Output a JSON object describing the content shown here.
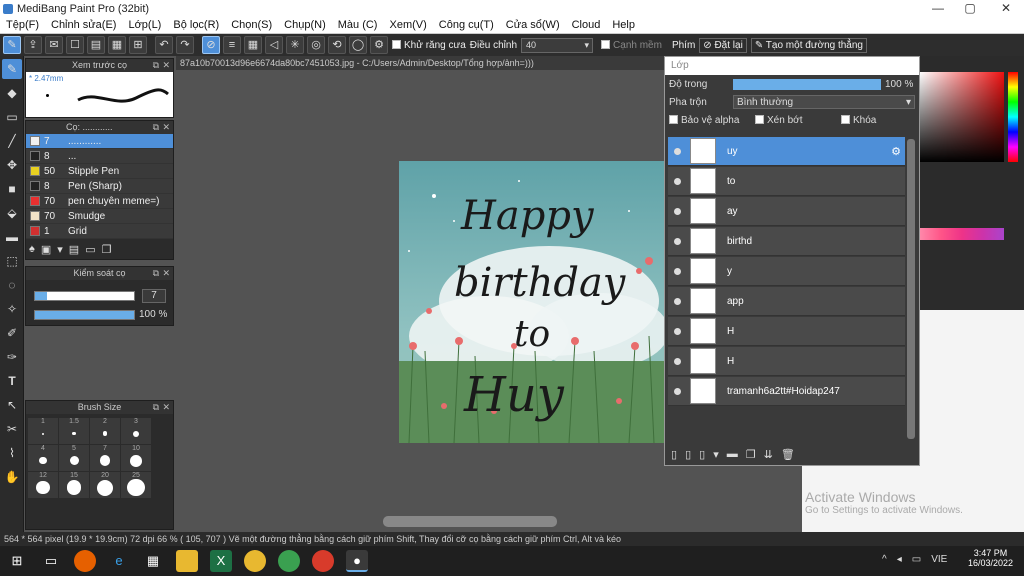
{
  "window": {
    "title": "MediBang Paint Pro (32bit)"
  },
  "menu": [
    "Tệp(F)",
    "Chỉnh sửa(E)",
    "Lớp(L)",
    "Bộ lọc(R)",
    "Chọn(S)",
    "Chụp(N)",
    "Màu (C)",
    "Xem(V)",
    "Công cụ(T)",
    "Cửa sổ(W)",
    "Cloud",
    "Help"
  ],
  "toolbar": {
    "antialias": "Khử răng cưa",
    "adjust_label": "Điều chỉnh",
    "adjust_value": "40",
    "smooth": "Cạnh mềm",
    "key_label": "Phím",
    "reset": "Đặt lại",
    "make_line": "Tạo một đường thẳng"
  },
  "preview": {
    "title": "Xem trước cọ",
    "size": "* 2.47mm"
  },
  "brushes": {
    "title": "Cọ: ............",
    "items": [
      {
        "size": "7",
        "name": "............",
        "color": "#f0f0f0",
        "selected": true
      },
      {
        "size": "8",
        "name": "...",
        "color": "#222222",
        "selected": false
      },
      {
        "size": "50",
        "name": "Stipple Pen",
        "color": "#e8d020",
        "selected": false
      },
      {
        "size": "8",
        "name": "Pen (Sharp)",
        "color": "#222222",
        "selected": false
      },
      {
        "size": "70",
        "name": "pen chuyên meme=)",
        "color": "#e83030",
        "selected": false
      },
      {
        "size": "70",
        "name": "Smudge",
        "color": "#f1e2c8",
        "selected": false
      },
      {
        "size": "1",
        "name": "Grid",
        "color": "#d03030",
        "selected": false
      }
    ]
  },
  "control": {
    "title": "Kiểm soát cọ",
    "size": "7",
    "opacity": "100 %"
  },
  "brushsize": {
    "title": "Brush Size",
    "labels": [
      "1",
      "1.5",
      "2",
      "3",
      "4",
      "5",
      "7",
      "10",
      "12",
      "15",
      "20",
      "25"
    ]
  },
  "document": {
    "tab": "87a10b70013d96e6674da80bc7451053.jpg - C:/Users/Admin/Desktop/Tổng hợp/ảnh=)))"
  },
  "canvas": {
    "text": [
      "Happy",
      "birthday",
      "to",
      "Huy"
    ]
  },
  "layers": {
    "title": "Lớp",
    "opacity_label": "Độ trong",
    "opacity_value": "100 %",
    "blend_label": "Pha trộn",
    "blend_value": "Bình thường",
    "protect_alpha": "Bảo vệ alpha",
    "clip": "Xén bớt",
    "lock": "Khóa",
    "items": [
      {
        "name": "uy",
        "selected": true
      },
      {
        "name": "to"
      },
      {
        "name": "ay"
      },
      {
        "name": "birthd"
      },
      {
        "name": "y"
      },
      {
        "name": "app"
      },
      {
        "name": "H"
      },
      {
        "name": "H"
      },
      {
        "name": "tramanh6a2tt#Hoidap247"
      }
    ]
  },
  "watermark": {
    "line1": "Activate Windows",
    "line2": "Go to Settings to activate Windows."
  },
  "status": "564 * 564 pixel   (19.9 * 19.9cm)   72 dpi   66 %   ( 105, 707 )   Vẽ một đường thẳng bằng cách giữ phím Shift, Thay đổi cỡ cọ bằng cách giữ phím Ctrl, Alt và kéo",
  "taskbar": {
    "lang": "VIE",
    "time": "3:47 PM",
    "date": "16/03/2022"
  }
}
